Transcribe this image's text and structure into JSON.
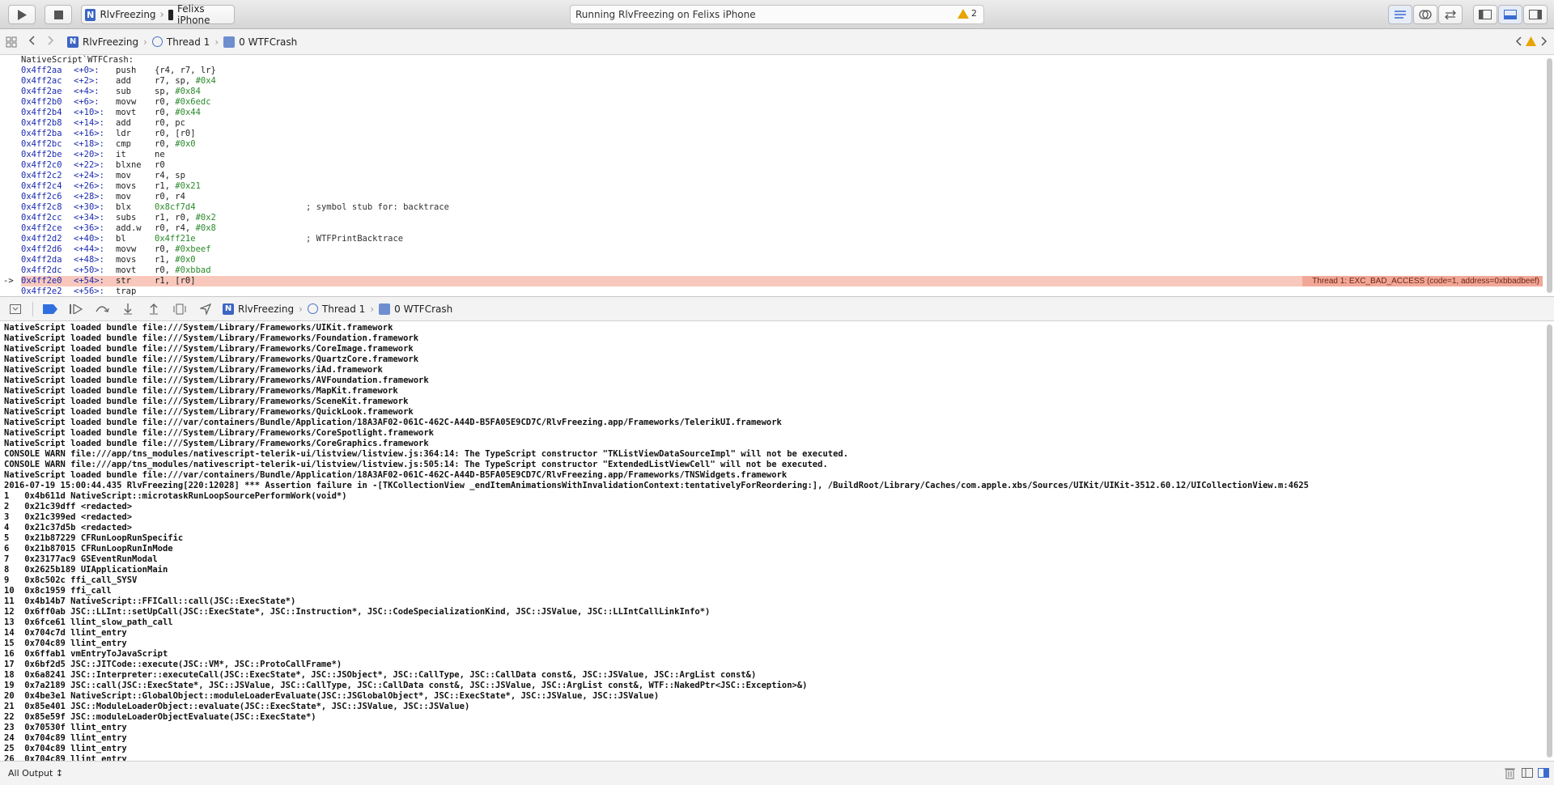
{
  "toolbar": {
    "scheme_app": "RlvFreezing",
    "scheme_device": "Felixs iPhone",
    "status_text": "Running RlvFreezing on Felixs iPhone",
    "warning_count": "2"
  },
  "jumpbar": {
    "app": "RlvFreezing",
    "thread": "Thread 1",
    "frame": "0 WTFCrash"
  },
  "disassembly": {
    "header": "NativeScript`WTFCrash:",
    "crash_message": "Thread 1: EXC_BAD_ACCESS (code=1, address=0xbbadbeef)",
    "comments": [
      "; symbol stub for: backtrace",
      "; WTFPrintBacktrace"
    ],
    "lines": [
      {
        "addr": "0x4ff2aa",
        "off": "<+0>:",
        "mn": "push",
        "op": "{r4, r7, lr}"
      },
      {
        "addr": "0x4ff2ac",
        "off": "<+2>:",
        "mn": "add",
        "op": "r7, sp, ",
        "hex": "#0x4"
      },
      {
        "addr": "0x4ff2ae",
        "off": "<+4>:",
        "mn": "sub",
        "op": "sp, ",
        "hex": "#0x84"
      },
      {
        "addr": "0x4ff2b0",
        "off": "<+6>:",
        "mn": "movw",
        "op": "r0, ",
        "hex": "#0x6edc"
      },
      {
        "addr": "0x4ff2b4",
        "off": "<+10>:",
        "mn": "movt",
        "op": "r0, ",
        "hex": "#0x44"
      },
      {
        "addr": "0x4ff2b8",
        "off": "<+14>:",
        "mn": "add",
        "op": "r0, pc"
      },
      {
        "addr": "0x4ff2ba",
        "off": "<+16>:",
        "mn": "ldr",
        "op": "r0, [r0]"
      },
      {
        "addr": "0x4ff2bc",
        "off": "<+18>:",
        "mn": "cmp",
        "op": "r0, ",
        "hex": "#0x0"
      },
      {
        "addr": "0x4ff2be",
        "off": "<+20>:",
        "mn": "it",
        "op": "ne"
      },
      {
        "addr": "0x4ff2c0",
        "off": "<+22>:",
        "mn": "blxne",
        "op": "r0"
      },
      {
        "addr": "0x4ff2c2",
        "off": "<+24>:",
        "mn": "mov",
        "op": "r4, sp"
      },
      {
        "addr": "0x4ff2c4",
        "off": "<+26>:",
        "mn": "movs",
        "op": "r1, ",
        "hex": "#0x21"
      },
      {
        "addr": "0x4ff2c6",
        "off": "<+28>:",
        "mn": "mov",
        "op": "r0, r4"
      },
      {
        "addr": "0x4ff2c8",
        "off": "<+30>:",
        "mn": "blx",
        "op": "",
        "hex": "0x8cf7d4",
        "cmt": 0
      },
      {
        "addr": "0x4ff2cc",
        "off": "<+34>:",
        "mn": "subs",
        "op": "r1, r0, ",
        "hex": "#0x2"
      },
      {
        "addr": "0x4ff2ce",
        "off": "<+36>:",
        "mn": "add.w",
        "op": "r0, r4, ",
        "hex": "#0x8"
      },
      {
        "addr": "0x4ff2d2",
        "off": "<+40>:",
        "mn": "bl",
        "op": "",
        "hex": "0x4ff21e",
        "cmt": 1
      },
      {
        "addr": "0x4ff2d6",
        "off": "<+44>:",
        "mn": "movw",
        "op": "r0, ",
        "hex": "#0xbeef"
      },
      {
        "addr": "0x4ff2da",
        "off": "<+48>:",
        "mn": "movs",
        "op": "r1, ",
        "hex": "#0x0"
      },
      {
        "addr": "0x4ff2dc",
        "off": "<+50>:",
        "mn": "movt",
        "op": "r0, ",
        "hex": "#0xbbad"
      },
      {
        "addr": "0x4ff2e0",
        "off": "<+54>:",
        "mn": "str",
        "op": "r1, [r0]",
        "current": true
      },
      {
        "addr": "0x4ff2e2",
        "off": "<+56>:",
        "mn": "trap",
        "op": ""
      }
    ]
  },
  "debugbar": {
    "app": "RlvFreezing",
    "thread": "Thread 1",
    "frame": "0 WTFCrash"
  },
  "console": {
    "lines": [
      "NativeScript loaded bundle file:///System/Library/Frameworks/UIKit.framework",
      "NativeScript loaded bundle file:///System/Library/Frameworks/Foundation.framework",
      "NativeScript loaded bundle file:///System/Library/Frameworks/CoreImage.framework",
      "NativeScript loaded bundle file:///System/Library/Frameworks/QuartzCore.framework",
      "NativeScript loaded bundle file:///System/Library/Frameworks/iAd.framework",
      "NativeScript loaded bundle file:///System/Library/Frameworks/AVFoundation.framework",
      "NativeScript loaded bundle file:///System/Library/Frameworks/MapKit.framework",
      "NativeScript loaded bundle file:///System/Library/Frameworks/SceneKit.framework",
      "NativeScript loaded bundle file:///System/Library/Frameworks/QuickLook.framework",
      "NativeScript loaded bundle file:///var/containers/Bundle/Application/18A3AF02-061C-462C-A44D-B5FA05E9CD7C/RlvFreezing.app/Frameworks/TelerikUI.framework",
      "NativeScript loaded bundle file:///System/Library/Frameworks/CoreSpotlight.framework",
      "NativeScript loaded bundle file:///System/Library/Frameworks/CoreGraphics.framework",
      "CONSOLE WARN file:///app/tns_modules/nativescript-telerik-ui/listview/listview.js:364:14: The TypeScript constructor \"TKListViewDataSourceImpl\" will not be executed.",
      "CONSOLE WARN file:///app/tns_modules/nativescript-telerik-ui/listview/listview.js:505:14: The TypeScript constructor \"ExtendedListViewCell\" will not be executed.",
      "NativeScript loaded bundle file:///var/containers/Bundle/Application/18A3AF02-061C-462C-A44D-B5FA05E9CD7C/RlvFreezing.app/Frameworks/TNSWidgets.framework",
      "2016-07-19 15:00:44.435 RlvFreezing[220:12028] *** Assertion failure in -[TKCollectionView _endItemAnimationsWithInvalidationContext:tentativelyForReordering:], /BuildRoot/Library/Caches/com.apple.xbs/Sources/UIKit/UIKit-3512.60.12/UICollectionView.m:4625",
      "1   0x4b611d NativeScript::microtaskRunLoopSourcePerformWork(void*)",
      "2   0x21c39dff <redacted>",
      "3   0x21c399ed <redacted>",
      "4   0x21c37d5b <redacted>",
      "5   0x21b87229 CFRunLoopRunSpecific",
      "6   0x21b87015 CFRunLoopRunInMode",
      "7   0x23177ac9 GSEventRunModal",
      "8   0x2625b189 UIApplicationMain",
      "9   0x8c502c ffi_call_SYSV",
      "10  0x8c1959 ffi_call",
      "11  0x4b14b7 NativeScript::FFICall::call(JSC::ExecState*)",
      "12  0x6ff0ab JSC::LLInt::setUpCall(JSC::ExecState*, JSC::Instruction*, JSC::CodeSpecializationKind, JSC::JSValue, JSC::LLIntCallLinkInfo*)",
      "13  0x6fce61 llint_slow_path_call",
      "14  0x704c7d llint_entry",
      "15  0x704c89 llint_entry",
      "16  0x6ffab1 vmEntryToJavaScript",
      "17  0x6bf2d5 JSC::JITCode::execute(JSC::VM*, JSC::ProtoCallFrame*)",
      "18  0x6a8241 JSC::Interpreter::executeCall(JSC::ExecState*, JSC::JSObject*, JSC::CallType, JSC::CallData const&, JSC::JSValue, JSC::ArgList const&)",
      "19  0x7a2189 JSC::call(JSC::ExecState*, JSC::JSValue, JSC::CallType, JSC::CallData const&, JSC::JSValue, JSC::ArgList const&, WTF::NakedPtr<JSC::Exception>&)",
      "20  0x4be3e1 NativeScript::GlobalObject::moduleLoaderEvaluate(JSC::JSGlobalObject*, JSC::ExecState*, JSC::JSValue, JSC::JSValue)",
      "21  0x85e401 JSC::ModuleLoaderObject::evaluate(JSC::ExecState*, JSC::JSValue, JSC::JSValue)",
      "22  0x85e59f JSC::moduleLoaderObjectEvaluate(JSC::ExecState*)",
      "23  0x70530f llint_entry",
      "24  0x704c89 llint_entry",
      "25  0x704c89 llint_entry",
      "26  0x704c89 llint_entry"
    ]
  },
  "bottombar": {
    "output_filter": "All Output ↕"
  }
}
